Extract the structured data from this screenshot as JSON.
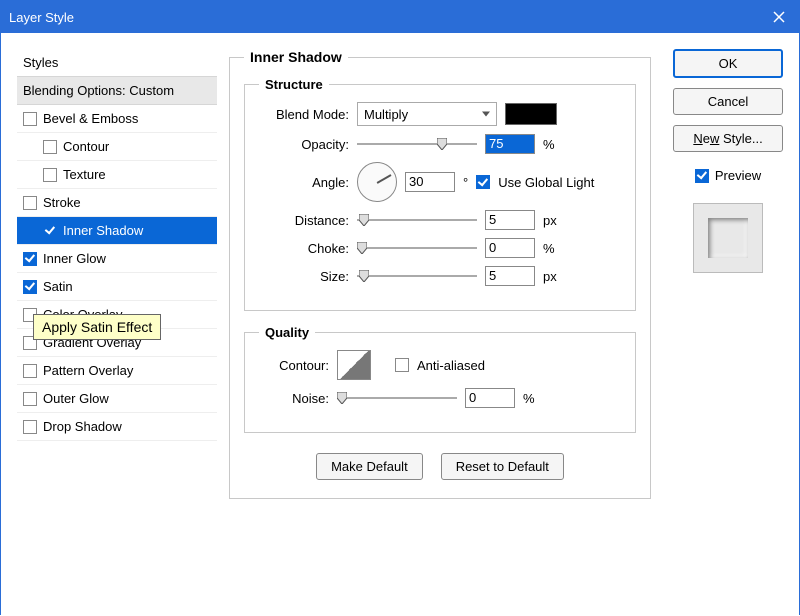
{
  "window": {
    "title": "Layer Style"
  },
  "sidebar": {
    "header": "Styles",
    "blending": "Blending Options: Custom",
    "items": [
      {
        "label": "Bevel & Emboss",
        "checked": false,
        "indent": false
      },
      {
        "label": "Contour",
        "checked": false,
        "indent": true
      },
      {
        "label": "Texture",
        "checked": false,
        "indent": true
      },
      {
        "label": "Stroke",
        "checked": false,
        "indent": false
      },
      {
        "label": "Inner Shadow",
        "checked": true,
        "indent": true,
        "selected": true
      },
      {
        "label": "Inner Glow",
        "checked": true,
        "indent": false
      },
      {
        "label": "Satin",
        "checked": true,
        "indent": false
      },
      {
        "label": "Color Overlay",
        "checked": false,
        "indent": false
      },
      {
        "label": "Gradient Overlay",
        "checked": false,
        "indent": false
      },
      {
        "label": "Pattern Overlay",
        "checked": false,
        "indent": false
      },
      {
        "label": "Outer Glow",
        "checked": false,
        "indent": false
      },
      {
        "label": "Drop Shadow",
        "checked": false,
        "indent": false
      }
    ]
  },
  "tooltip": "Apply Satin Effect",
  "panel_title": "Inner Shadow",
  "structure": {
    "legend": "Structure",
    "blend_mode_label": "Blend Mode:",
    "blend_mode_value": "Multiply",
    "color": "#000000",
    "opacity_label": "Opacity:",
    "opacity_value": "75",
    "opacity_unit": "%",
    "angle_label": "Angle:",
    "angle_value": "30",
    "angle_unit": "°",
    "global_light_label": "Use Global Light",
    "global_light_checked": true,
    "distance_label": "Distance:",
    "distance_value": "5",
    "distance_unit": "px",
    "choke_label": "Choke:",
    "choke_value": "0",
    "choke_unit": "%",
    "size_label": "Size:",
    "size_value": "5",
    "size_unit": "px"
  },
  "quality": {
    "legend": "Quality",
    "contour_label": "Contour:",
    "anti_aliased_label": "Anti-aliased",
    "anti_aliased_checked": false,
    "noise_label": "Noise:",
    "noise_value": "0",
    "noise_unit": "%"
  },
  "buttons": {
    "make_default": "Make Default",
    "reset_default": "Reset to Default",
    "ok": "OK",
    "cancel": "Cancel",
    "new_style": "New Style...",
    "preview": "Preview"
  }
}
